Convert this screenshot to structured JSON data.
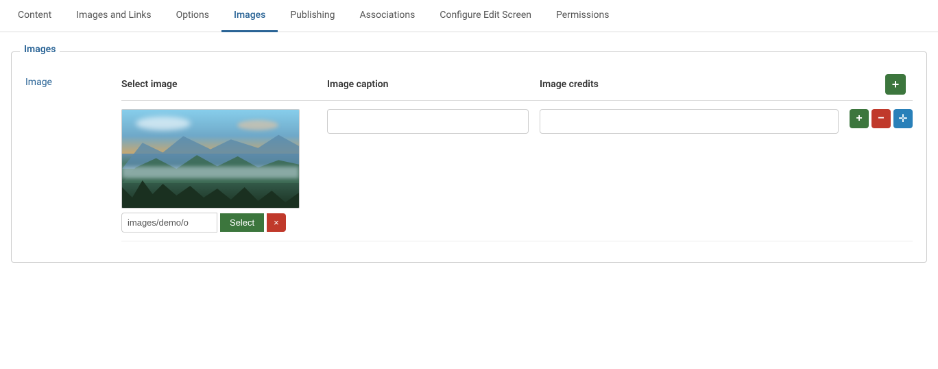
{
  "tabs": [
    {
      "id": "content",
      "label": "Content",
      "active": false
    },
    {
      "id": "images-and-links",
      "label": "Images and Links",
      "active": false
    },
    {
      "id": "options",
      "label": "Options",
      "active": false
    },
    {
      "id": "images",
      "label": "Images",
      "active": true
    },
    {
      "id": "publishing",
      "label": "Publishing",
      "active": false
    },
    {
      "id": "associations",
      "label": "Associations",
      "active": false
    },
    {
      "id": "configure-edit-screen",
      "label": "Configure Edit Screen",
      "active": false
    },
    {
      "id": "permissions",
      "label": "Permissions",
      "active": false
    }
  ],
  "section": {
    "legend": "Images",
    "image_label": "Image",
    "columns": {
      "select_image": "Select image",
      "caption": "Image caption",
      "credits": "Image credits"
    },
    "row": {
      "file_path": "images/demo/o",
      "caption_placeholder": "",
      "credits_placeholder": "",
      "select_btn_label": "Select",
      "clear_btn_label": "×"
    },
    "add_btn_label": "+",
    "row_add_label": "+",
    "row_remove_label": "−",
    "row_move_label": "✛"
  }
}
